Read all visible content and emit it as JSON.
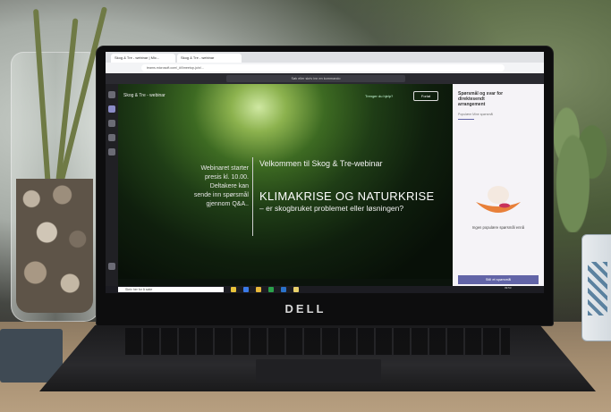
{
  "browser": {
    "tabs": [
      "Skog & Tre - webinar | Mic...",
      "Skog & Tre - webinar"
    ],
    "url": "teams.microsoft.com/_#/l/meetup-join/..."
  },
  "teams": {
    "search_placeholder": "Søk eller skriv inn en kommando"
  },
  "stage": {
    "meeting_title": "Skog & Tre - webinar",
    "help_link": "Trenger du hjelp?",
    "leave_button": "Forlat",
    "start_info_lines": [
      "Webinaret starter",
      "presis kl. 10.00.",
      "Deltakere kan",
      "sende inn spørsmål",
      "gjennom Q&A.."
    ],
    "welcome": "Velkommen til Skog & Tre-webinar",
    "headline": "KLIMAKRISE OG NATURKRISE",
    "subline": "– er skogbruket problemet eller løsningen?"
  },
  "qa_panel": {
    "title": "Spørsmål og svar for direktesendt arrangement",
    "tabs": "Populære   Mine spørsmål",
    "empty_text": "Ingen populære spørsmål ennå",
    "ask_button": "Still et spørsmål"
  },
  "taskbar": {
    "search_placeholder": "Skriv her for å søke",
    "clock": [
      "09:53",
      "04.06.2020"
    ]
  },
  "laptop": {
    "brand": "DELL"
  }
}
